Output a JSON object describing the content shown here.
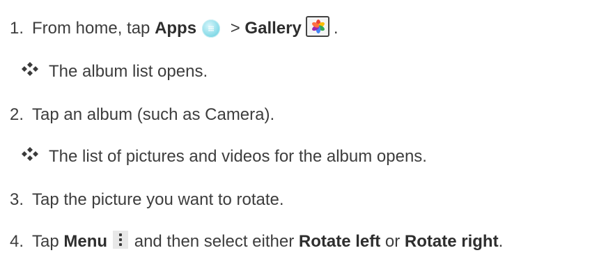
{
  "steps": [
    {
      "number": "1.",
      "prefix": "From home, tap ",
      "apps_label": "Apps",
      "separator": " > ",
      "gallery_label": "Gallery",
      "suffix": ".",
      "icons": [
        "apps-icon",
        "gallery-icon"
      ]
    },
    {
      "result": "The album list opens."
    },
    {
      "number": "2.",
      "text": "Tap an album (such as Camera)."
    },
    {
      "result": "The list of pictures and videos for the album opens."
    },
    {
      "number": "3.",
      "text": "Tap the picture you want to rotate."
    },
    {
      "number": "4.",
      "prefix": "Tap ",
      "menu_label": "Menu",
      "middle": " and then select either ",
      "rotate_left": "Rotate left",
      "or": " or ",
      "rotate_right": "Rotate right",
      "suffix": ".",
      "icons": [
        "menu-icon"
      ]
    }
  ]
}
